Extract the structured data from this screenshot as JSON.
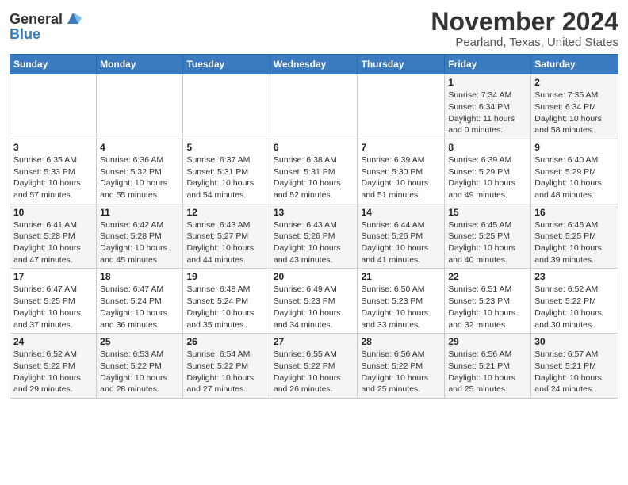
{
  "header": {
    "logo_general": "General",
    "logo_blue": "Blue",
    "title": "November 2024",
    "subtitle": "Pearland, Texas, United States"
  },
  "days_of_week": [
    "Sunday",
    "Monday",
    "Tuesday",
    "Wednesday",
    "Thursday",
    "Friday",
    "Saturday"
  ],
  "weeks": [
    [
      {
        "num": "",
        "info": ""
      },
      {
        "num": "",
        "info": ""
      },
      {
        "num": "",
        "info": ""
      },
      {
        "num": "",
        "info": ""
      },
      {
        "num": "",
        "info": ""
      },
      {
        "num": "1",
        "info": "Sunrise: 7:34 AM\nSunset: 6:34 PM\nDaylight: 11 hours and 0 minutes."
      },
      {
        "num": "2",
        "info": "Sunrise: 7:35 AM\nSunset: 6:34 PM\nDaylight: 10 hours and 58 minutes."
      }
    ],
    [
      {
        "num": "3",
        "info": "Sunrise: 6:35 AM\nSunset: 5:33 PM\nDaylight: 10 hours and 57 minutes."
      },
      {
        "num": "4",
        "info": "Sunrise: 6:36 AM\nSunset: 5:32 PM\nDaylight: 10 hours and 55 minutes."
      },
      {
        "num": "5",
        "info": "Sunrise: 6:37 AM\nSunset: 5:31 PM\nDaylight: 10 hours and 54 minutes."
      },
      {
        "num": "6",
        "info": "Sunrise: 6:38 AM\nSunset: 5:31 PM\nDaylight: 10 hours and 52 minutes."
      },
      {
        "num": "7",
        "info": "Sunrise: 6:39 AM\nSunset: 5:30 PM\nDaylight: 10 hours and 51 minutes."
      },
      {
        "num": "8",
        "info": "Sunrise: 6:39 AM\nSunset: 5:29 PM\nDaylight: 10 hours and 49 minutes."
      },
      {
        "num": "9",
        "info": "Sunrise: 6:40 AM\nSunset: 5:29 PM\nDaylight: 10 hours and 48 minutes."
      }
    ],
    [
      {
        "num": "10",
        "info": "Sunrise: 6:41 AM\nSunset: 5:28 PM\nDaylight: 10 hours and 47 minutes."
      },
      {
        "num": "11",
        "info": "Sunrise: 6:42 AM\nSunset: 5:28 PM\nDaylight: 10 hours and 45 minutes."
      },
      {
        "num": "12",
        "info": "Sunrise: 6:43 AM\nSunset: 5:27 PM\nDaylight: 10 hours and 44 minutes."
      },
      {
        "num": "13",
        "info": "Sunrise: 6:43 AM\nSunset: 5:26 PM\nDaylight: 10 hours and 43 minutes."
      },
      {
        "num": "14",
        "info": "Sunrise: 6:44 AM\nSunset: 5:26 PM\nDaylight: 10 hours and 41 minutes."
      },
      {
        "num": "15",
        "info": "Sunrise: 6:45 AM\nSunset: 5:25 PM\nDaylight: 10 hours and 40 minutes."
      },
      {
        "num": "16",
        "info": "Sunrise: 6:46 AM\nSunset: 5:25 PM\nDaylight: 10 hours and 39 minutes."
      }
    ],
    [
      {
        "num": "17",
        "info": "Sunrise: 6:47 AM\nSunset: 5:25 PM\nDaylight: 10 hours and 37 minutes."
      },
      {
        "num": "18",
        "info": "Sunrise: 6:47 AM\nSunset: 5:24 PM\nDaylight: 10 hours and 36 minutes."
      },
      {
        "num": "19",
        "info": "Sunrise: 6:48 AM\nSunset: 5:24 PM\nDaylight: 10 hours and 35 minutes."
      },
      {
        "num": "20",
        "info": "Sunrise: 6:49 AM\nSunset: 5:23 PM\nDaylight: 10 hours and 34 minutes."
      },
      {
        "num": "21",
        "info": "Sunrise: 6:50 AM\nSunset: 5:23 PM\nDaylight: 10 hours and 33 minutes."
      },
      {
        "num": "22",
        "info": "Sunrise: 6:51 AM\nSunset: 5:23 PM\nDaylight: 10 hours and 32 minutes."
      },
      {
        "num": "23",
        "info": "Sunrise: 6:52 AM\nSunset: 5:22 PM\nDaylight: 10 hours and 30 minutes."
      }
    ],
    [
      {
        "num": "24",
        "info": "Sunrise: 6:52 AM\nSunset: 5:22 PM\nDaylight: 10 hours and 29 minutes."
      },
      {
        "num": "25",
        "info": "Sunrise: 6:53 AM\nSunset: 5:22 PM\nDaylight: 10 hours and 28 minutes."
      },
      {
        "num": "26",
        "info": "Sunrise: 6:54 AM\nSunset: 5:22 PM\nDaylight: 10 hours and 27 minutes."
      },
      {
        "num": "27",
        "info": "Sunrise: 6:55 AM\nSunset: 5:22 PM\nDaylight: 10 hours and 26 minutes."
      },
      {
        "num": "28",
        "info": "Sunrise: 6:56 AM\nSunset: 5:22 PM\nDaylight: 10 hours and 25 minutes."
      },
      {
        "num": "29",
        "info": "Sunrise: 6:56 AM\nSunset: 5:21 PM\nDaylight: 10 hours and 25 minutes."
      },
      {
        "num": "30",
        "info": "Sunrise: 6:57 AM\nSunset: 5:21 PM\nDaylight: 10 hours and 24 minutes."
      }
    ]
  ]
}
